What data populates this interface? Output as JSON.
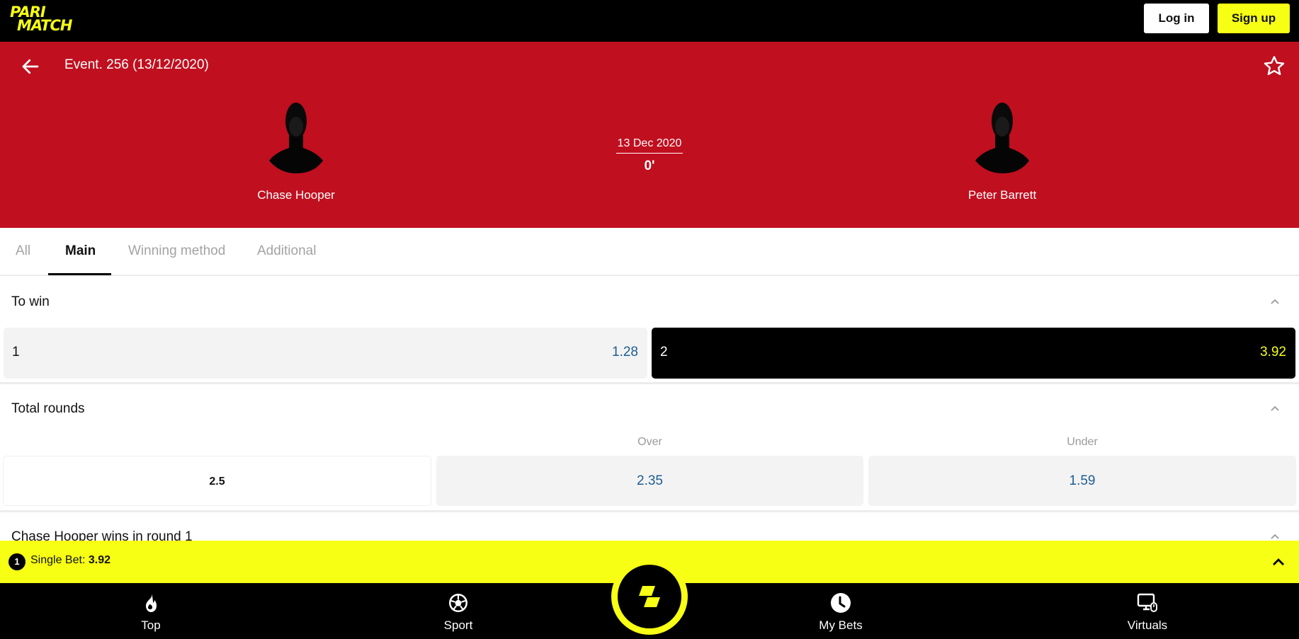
{
  "header": {
    "logo_line1": "PARI",
    "logo_line2": "MATCH",
    "login_label": "Log in",
    "signup_label": "Sign up"
  },
  "colors": {
    "brand_yellow": "#f7ff14",
    "event_red": "#c00f1f",
    "odds_blue": "#1d5d91"
  },
  "event": {
    "title": "Event. 256 (13/12/2020)",
    "date": "13 Dec 2020",
    "time": "0'",
    "player1": "Chase Hooper",
    "player2": "Peter Barrett",
    "icons": {
      "back": "arrow-left-icon",
      "favorite": "star-outline-icon",
      "avatar": "person-silhouette-icon"
    }
  },
  "tabs": [
    {
      "label": "All",
      "active": false
    },
    {
      "label": "Main",
      "active": true
    },
    {
      "label": "Winning method",
      "active": false
    },
    {
      "label": "Additional",
      "active": false
    }
  ],
  "markets": {
    "to_win": {
      "title": "To win",
      "outcomes": [
        {
          "label": "1",
          "odds": "1.28",
          "selected": false
        },
        {
          "label": "2",
          "odds": "3.92",
          "selected": true
        }
      ]
    },
    "total_rounds": {
      "title": "Total rounds",
      "columns": [
        "Over",
        "Under"
      ],
      "rows": [
        {
          "line": "2.5",
          "over": "2.35",
          "under": "1.59"
        }
      ]
    },
    "next": {
      "title": "Chase Hooper wins in round 1"
    }
  },
  "betslip": {
    "count": "1",
    "label": "Single Bet:",
    "odds": "3.92"
  },
  "bottom_nav": [
    {
      "label": "Top",
      "icon": "flame-icon"
    },
    {
      "label": "Sport",
      "icon": "soccer-ball-icon"
    },
    {
      "label": "My Bets",
      "icon": "clock-icon"
    },
    {
      "label": "Virtuals",
      "icon": "monitor-icon"
    }
  ]
}
